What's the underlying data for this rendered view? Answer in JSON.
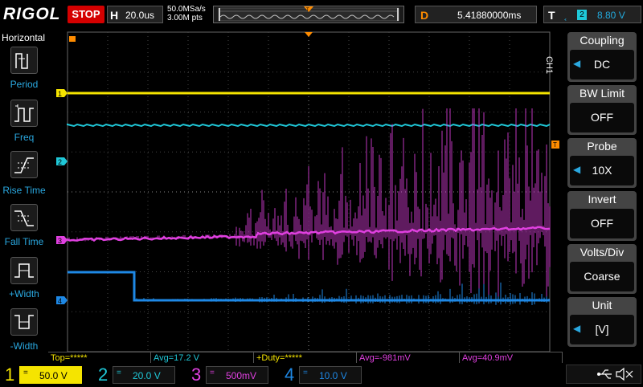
{
  "header": {
    "brand": "RIGOL",
    "run_state": "STOP",
    "horizontal": {
      "key": "H",
      "timebase": "20.0us"
    },
    "sample_rate": "50.0MSa/s",
    "mem_depth": "3.00M pts",
    "delay": {
      "key": "D",
      "value": "5.41880000ms"
    },
    "trigger": {
      "key": "T",
      "source": "2",
      "level": "8.80 V"
    }
  },
  "left_menu": {
    "title": "Horizontal",
    "items": [
      {
        "label": "Period",
        "icon": "period-icon"
      },
      {
        "label": "Freq",
        "icon": "frequency-icon"
      },
      {
        "label": "Rise Time",
        "icon": "rise-time-icon"
      },
      {
        "label": "Fall Time",
        "icon": "fall-time-icon"
      },
      {
        "label": "+Width",
        "icon": "positive-width-icon"
      },
      {
        "label": "-Width",
        "icon": "negative-width-icon"
      }
    ]
  },
  "right_menu": {
    "channel_tag": "CH1",
    "items": [
      {
        "title": "Coupling",
        "value": "DC",
        "arrow": true
      },
      {
        "title": "BW Limit",
        "value": "OFF",
        "arrow": false
      },
      {
        "title": "Probe",
        "value": "10X",
        "arrow": true
      },
      {
        "title": "Invert",
        "value": "OFF",
        "arrow": false
      },
      {
        "title": "Volts/Div",
        "value": "Coarse",
        "arrow": false
      },
      {
        "title": "Unit",
        "value": "[V]",
        "arrow": true
      }
    ]
  },
  "measurements": [
    {
      "label": "Top=*****",
      "color": "#f5e400"
    },
    {
      "label": "Avg=17.2 V",
      "color": "#1fc8d8"
    },
    {
      "label": "+Duty=*****",
      "color": "#f5e400"
    },
    {
      "label": "Avg=-981mV",
      "color": "#e040e0"
    },
    {
      "label": "Avg=40.9mV",
      "color": "#e040e0"
    }
  ],
  "channels": [
    {
      "num": "1",
      "coupling": "=",
      "scale": "50.0 V",
      "color": "#f5e400",
      "active": true
    },
    {
      "num": "2",
      "coupling": "=",
      "scale": "20.0 V",
      "color": "#1fc8d8",
      "active": false
    },
    {
      "num": "3",
      "coupling": "=",
      "scale": "500mV",
      "color": "#e040e0",
      "active": false
    },
    {
      "num": "4",
      "coupling": "=",
      "scale": "10.0 V",
      "color": "#1e88e5",
      "active": false
    }
  ],
  "trace_markers": [
    "1",
    "2",
    "3",
    "4"
  ],
  "colors": {
    "ch1": "#f5e400",
    "ch2": "#1fc8d8",
    "ch3": "#e040e0",
    "ch4": "#1e88e5",
    "trigger": "#ff8c00",
    "stop": "#d40000"
  },
  "status_icons": [
    "usb-icon",
    "speaker-muted-icon"
  ]
}
